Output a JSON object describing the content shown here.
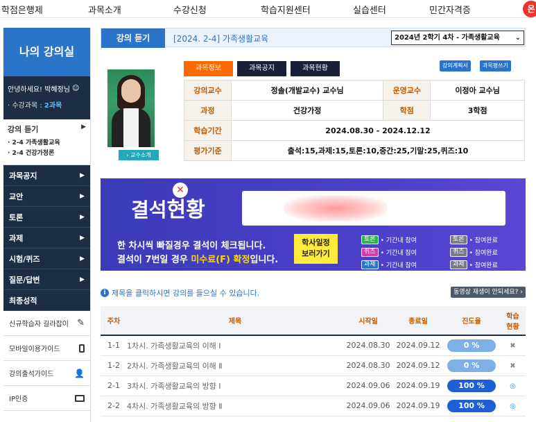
{
  "nav": {
    "items": [
      "학점은행제",
      "과목소개",
      "수강신청",
      "학습지원센터",
      "실습센터",
      "민간자격증"
    ],
    "badge": "온"
  },
  "sidebar": {
    "title": "나의 강의실",
    "hello": "안녕하세요! 박혜정님",
    "course_count_label": "· 수강과목 :",
    "course_count_value": "2과목",
    "lecture_head": "강의 듣기",
    "lecture_items": [
      "· 2-4 가족생활교육",
      "· 2-4 건강가정론"
    ],
    "menu": [
      "과목공지",
      "교안",
      "토론",
      "과제",
      "시험/퀴즈",
      "질문/답변",
      "최종성적"
    ],
    "guides": [
      "신규학습자 길라잡이",
      "모바일이용가이드",
      "강의출석가이드",
      "IP인증"
    ]
  },
  "lecture_bar": {
    "label": "강의 듣기",
    "course": "[2024. 2-4] 가족생활교육",
    "select_value": "2024년 2학기 4차 - 가족생활교육"
  },
  "profile": {
    "intro_button": "› 교수소개"
  },
  "tabs": {
    "items": [
      "과목정보",
      "과목공지",
      "과목현황"
    ],
    "plan_button": "강의계획서",
    "eval_button": "과목평쓰기"
  },
  "info": {
    "professor_label": "강의교수",
    "professor_value": "정솔(개발교수) 교수님",
    "operator_label": "운영교수",
    "operator_value": "이정아 교수님",
    "course_label": "과정",
    "course_value": "건강가정",
    "credit_label": "학점",
    "credit_value": "3학점",
    "period_label": "학습기간",
    "period_value": "2024.08.30 - 2024.12.12",
    "eval_label": "평가기준",
    "eval_value": "출석:15,과제:15,토론:10,중간:25,기말:25,퀴즈:10"
  },
  "banner": {
    "title_a": "결석",
    "title_b": "현황",
    "line1": "한 차시씩 빠질경우 결석이 체크됩니다.",
    "line2_a": "결석이 7번일 경우 ",
    "line2_b": "미수료(F) 확정",
    "line2_c": "입니다.",
    "cal_button": "학사일정\n보러가기",
    "legend": [
      {
        "tag": "토론",
        "text": "• 기간내 참여"
      },
      {
        "tag": "퀴즈",
        "text": "• 기간내 참여"
      },
      {
        "tag": "과제",
        "text": "• 기간내 참여"
      },
      {
        "tag": "토론",
        "text": "• 참여완료"
      },
      {
        "tag": "퀴즈",
        "text": "• 참여완료"
      },
      {
        "tag": "과제",
        "text": "• 참여완료"
      }
    ]
  },
  "notice": {
    "text": "제목을 클릭하시면 강의를 들으실 수 있습니다.",
    "video_button": "동영상 재생이 안되세요? ›"
  },
  "table": {
    "headers": [
      "주차",
      "제목",
      "시작일",
      "종료일",
      "진도율",
      "학습\n현황"
    ],
    "rows": [
      {
        "week": "1-1",
        "title": "1차시. 가족생활교육의 이해 Ⅰ",
        "start": "2024.08.30",
        "end": "2024.09.12",
        "progress": "0 %",
        "pct": 0,
        "status": "✖"
      },
      {
        "week": "1-2",
        "title": "2차시. 가족생활교육의 이해 Ⅱ",
        "start": "2024.08.30",
        "end": "2024.09.12",
        "progress": "0 %",
        "pct": 0,
        "status": "✖"
      },
      {
        "week": "2-1",
        "title": "3차시. 가족생활교육의 방향 Ⅰ",
        "start": "2024.09.06",
        "end": "2024.09.19",
        "progress": "100 %",
        "pct": 100,
        "status": "◎"
      },
      {
        "week": "2-2",
        "title": "4차시. 가족생활교육의 방향 Ⅱ",
        "start": "2024.09.06",
        "end": "2024.09.19",
        "progress": "100 %",
        "pct": 100,
        "status": "◎"
      }
    ]
  }
}
